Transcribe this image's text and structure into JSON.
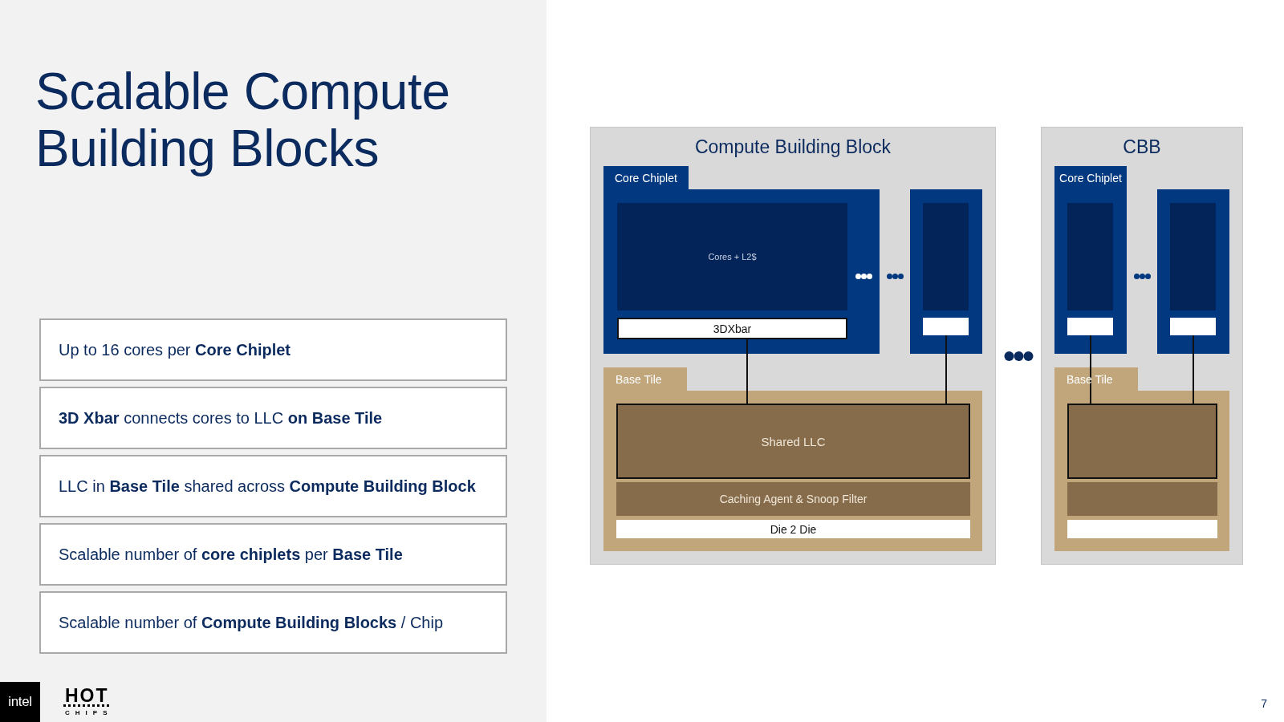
{
  "left_panel": {
    "title": "Scalable Compute Building Blocks",
    "bullets": [
      "Up to 16 cores per **Core Chiplet**",
      "**3D Xbar** connects cores to LLC **on Base Tile**",
      "LLC in **Base Tile** shared across **Compute Building Block**",
      "Scalable number of **core chiplets** per **Base Tile**",
      "Scalable number of **Compute Building Blocks** / Chip"
    ]
  },
  "diagram": {
    "blocks": [
      {
        "title": "Compute Building Block",
        "chiplets": [
          {
            "kind": "wide",
            "tab": "Core Chiplet",
            "cores": "Cores + L2$",
            "xbar": "3DXbar"
          },
          {
            "kind": "narrow"
          }
        ],
        "base_tile": {
          "tab": "Base Tile",
          "llc": "Shared LLC",
          "agent": "Caching Agent & Snoop Filter",
          "die_to_die": "Die 2 Die"
        }
      },
      {
        "title": "CBB",
        "chiplets": [
          {
            "kind": "narrow",
            "tab": "Core Chiplet"
          },
          {
            "kind": "narrow"
          }
        ],
        "base_tile": {
          "tab": "Base Tile"
        }
      }
    ]
  },
  "footer": {
    "logos": [
      {
        "kind": "tile",
        "text": "intel"
      },
      {
        "kind": "wordmark",
        "text": "HOT",
        "subtext": "CHIPS"
      }
    ],
    "page_number": "7"
  }
}
